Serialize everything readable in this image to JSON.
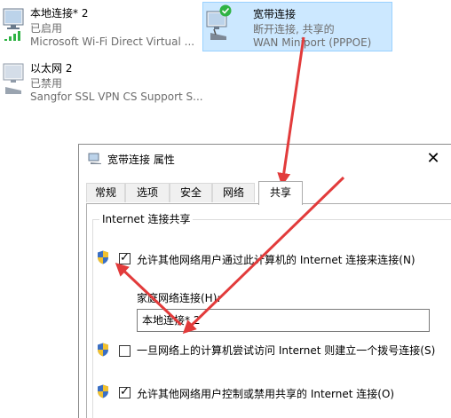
{
  "adapters": [
    {
      "name": "本地连接* 2",
      "status": "已启用",
      "device": "Microsoft Wi-Fi Direct Virtual ..."
    },
    {
      "name": "宽带连接",
      "status": "断开连接, 共享的",
      "device": "WAN Miniport (PPPOE)"
    },
    {
      "name": "以太网 2",
      "status": "已禁用",
      "device": "Sangfor SSL VPN CS Support S..."
    }
  ],
  "dialog": {
    "title": "宽带连接 属性",
    "close_glyph": "✕",
    "tabs": [
      "常规",
      "选项",
      "安全",
      "网络",
      "共享"
    ],
    "active_tab": "共享",
    "group_title": "Internet 连接共享",
    "allow_share_label": "允许其他网络用户通过此计算机的 Internet 连接来连接(N)",
    "home_network_label": "家庭网络连接(H):",
    "home_network_value": "本地连接* 2",
    "dial_on_demand_label": "一旦网络上的计算机尝试访问 Internet 则建立一个拨号连接(S)",
    "allow_control_label": "允许其他网络用户控制或禁用共享的 Internet 连接(O)"
  },
  "checkbox_state": {
    "allow_share": true,
    "dial_on_demand": false,
    "allow_control": true
  },
  "colors": {
    "selection_bg": "#cce8ff",
    "annotation_arrow": "#e23b3b",
    "status_ok": "#2fb344"
  },
  "icons": [
    "wifi-adapter-icon",
    "broadband-adapter-icon",
    "ethernet-adapter-icon",
    "check-badge-icon",
    "uac-shield-icon",
    "close-icon",
    "connection-title-icon"
  ]
}
